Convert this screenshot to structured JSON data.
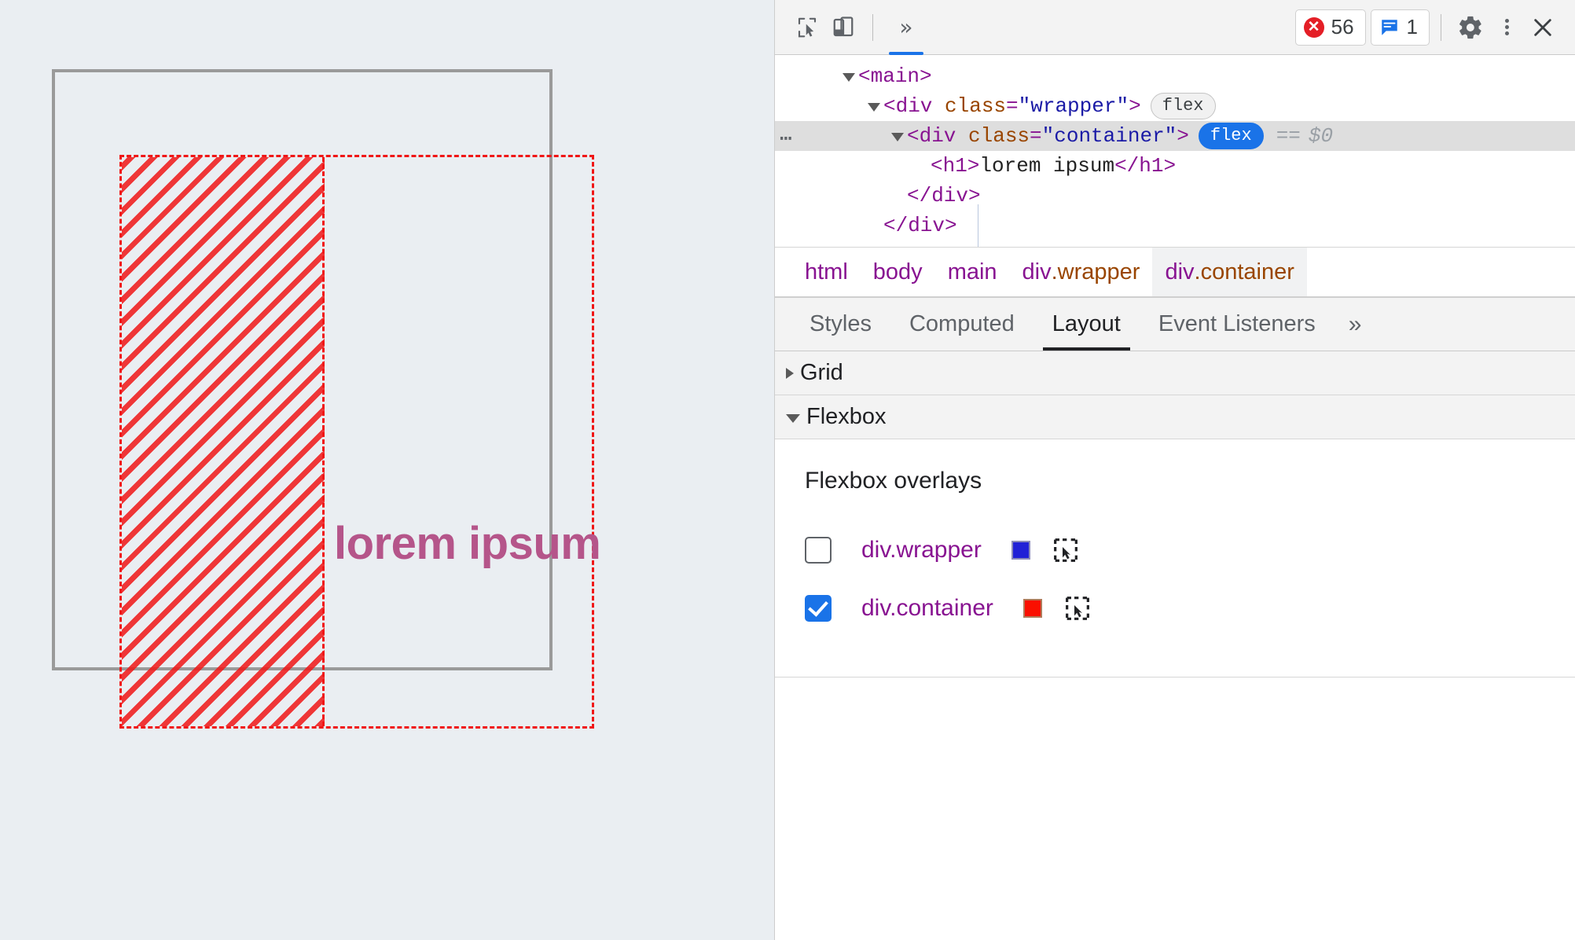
{
  "page": {
    "heading": "lorem ipsum",
    "heading_color": "#b5558a",
    "background": "#eaeef2",
    "overlay_color": "#f01616"
  },
  "devtools": {
    "toolbar": {
      "inspect_tooltip": "Inspect element",
      "device_tooltip": "Toggle device toolbar",
      "overflow_label": "»",
      "errors_count": "56",
      "messages_count": "1",
      "settings_label": "Settings",
      "menu_label": "Customize and control DevTools",
      "close_label": "Close DevTools",
      "error_color": "#e41e26",
      "message_color": "#1a73e8"
    },
    "dom": {
      "rows": [
        {
          "indent": 0,
          "text": "<main>",
          "twisty": "open"
        },
        {
          "indent": 1,
          "text": "<div class=\"wrapper\">",
          "twisty": "open",
          "badge": "flex"
        },
        {
          "indent": 2,
          "text": "<div class=\"container\">",
          "twisty": "open",
          "badge": "flex",
          "selected": true,
          "eq": "==",
          "ref": "$0"
        },
        {
          "indent": 3,
          "text": "<h1>lorem ipsum</h1>"
        },
        {
          "indent": 2,
          "text": "</div>"
        },
        {
          "indent": 1,
          "text": "</div>"
        }
      ],
      "tag_main": "main",
      "tag_div": "div",
      "tag_h1": "h1",
      "attr_class": "class",
      "val_wrapper": "\"wrapper\"",
      "val_container": "\"container\"",
      "h1_text": "lorem ipsum",
      "badge_flex": "flex",
      "equals": "==",
      "selected_ref": "$0",
      "more_ellipsis": "…"
    },
    "breadcrumb": [
      {
        "label": "html",
        "active": false
      },
      {
        "label": "body",
        "active": false
      },
      {
        "label": "main",
        "active": false
      },
      {
        "label": "div.wrapper",
        "tag": "div",
        "cls": ".wrapper",
        "active": false
      },
      {
        "label": "div.container",
        "tag": "div",
        "cls": ".container",
        "active": true
      }
    ],
    "tabs": [
      {
        "label": "Styles",
        "active": false
      },
      {
        "label": "Computed",
        "active": false
      },
      {
        "label": "Layout",
        "active": true
      },
      {
        "label": "Event Listeners",
        "active": false
      },
      {
        "label": "»",
        "active": false,
        "more": true
      }
    ],
    "layout": {
      "grid_section": {
        "title": "Grid",
        "expanded": false
      },
      "flex_section": {
        "title": "Flexbox",
        "expanded": true
      },
      "overlays_title": "Flexbox overlays",
      "overlays": [
        {
          "label": "div.wrapper",
          "checked": false,
          "color": "#2121d6"
        },
        {
          "label": "div.container",
          "checked": true,
          "color": "#fa0f00"
        }
      ]
    }
  }
}
